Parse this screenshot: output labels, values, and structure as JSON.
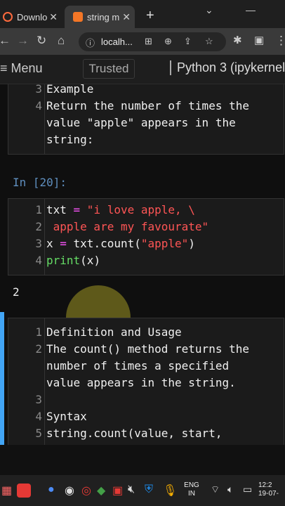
{
  "browser": {
    "tabs": [
      {
        "title": "Downlo",
        "close": "✕"
      },
      {
        "title": "string m",
        "close": "✕"
      }
    ],
    "new_tab": "+",
    "window_controls": {
      "chevron": "⌄",
      "minimize": "—"
    },
    "url": "localh...",
    "icons": [
      "back-icon",
      "forward-icon",
      "reload-icon",
      "home-icon",
      "info-icon",
      "translate-icon",
      "zoom-icon",
      "share-icon",
      "star-icon",
      "extensions-icon",
      "sidepanel-icon",
      "menu-icon"
    ]
  },
  "jupyter": {
    "menu_label": "≡ Menu",
    "trusted_label": "Trusted",
    "kernel_label": "Python 3 (ipykernel"
  },
  "cells": {
    "md1": {
      "lines": [
        {
          "num": "3",
          "text": "Example"
        },
        {
          "num": "4",
          "text": "Return the number of times the"
        },
        {
          "num": "",
          "text": "value \"apple\" appears in the"
        },
        {
          "num": "",
          "text": "string:"
        }
      ]
    },
    "code1": {
      "prompt": "In [20]:",
      "lines": [
        {
          "num": "1",
          "parts": {
            "a": "txt ",
            "b": "=",
            "c": " \"i love apple, \\"
          }
        },
        {
          "num": "2",
          "parts": {
            "a": " apple are my favourate\""
          }
        },
        {
          "num": "3",
          "parts": {
            "a": "x ",
            "b": "=",
            "c": " txt.count(",
            "d": "\"apple\"",
            "e": ")"
          }
        },
        {
          "num": "4",
          "parts": {
            "a": "print",
            "b": "(x)"
          }
        }
      ],
      "output": "2"
    },
    "md2": {
      "lines": [
        {
          "num": "1",
          "text": "Definition and Usage"
        },
        {
          "num": "2",
          "text": "The count() method returns the"
        },
        {
          "num": "",
          "text": "number of times a specified"
        },
        {
          "num": "",
          "text": "value appears in the string."
        },
        {
          "num": "3",
          "text": ""
        },
        {
          "num": "4",
          "text": "Syntax"
        },
        {
          "num": "5",
          "text": "string.count(value, start,"
        }
      ]
    }
  },
  "taskbar": {
    "lang_line1": "ENG",
    "lang_line2": "IN",
    "time": "12:2",
    "date": "19-07-"
  },
  "colors": {
    "keyword": "#66dd66",
    "string": "#ff5555",
    "operator": "#ff55ff",
    "prompt": "#5f8fbf",
    "selected_cell": "#42a5f5"
  }
}
